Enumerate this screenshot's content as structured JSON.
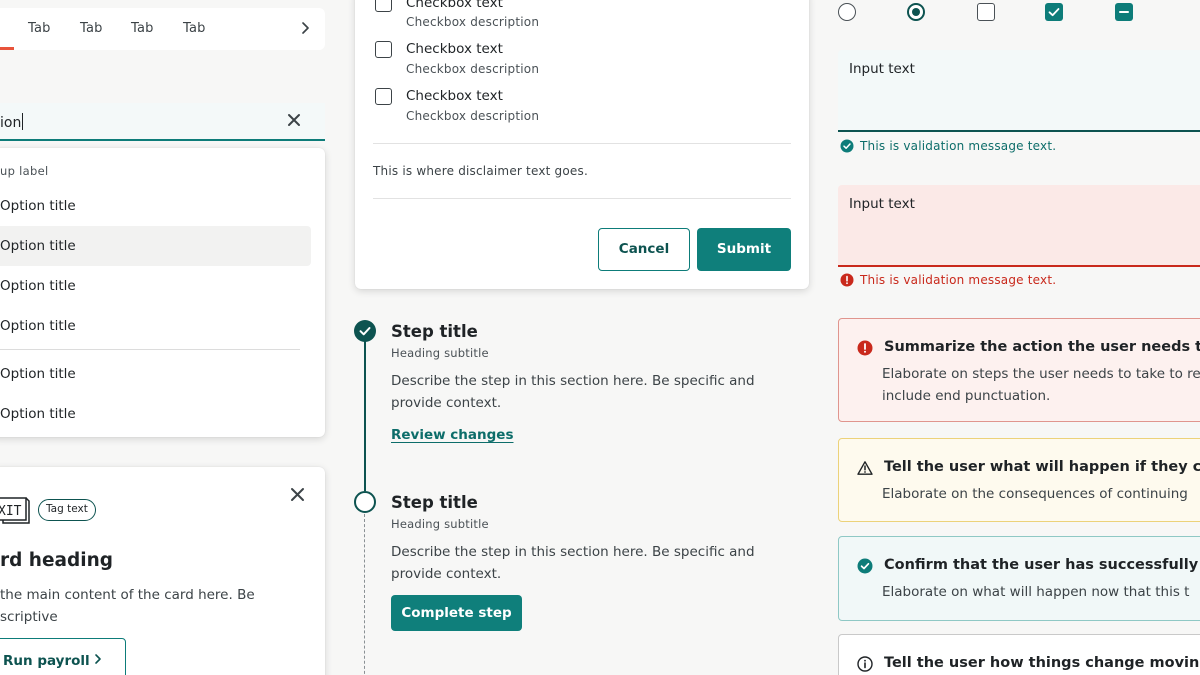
{
  "tabs": {
    "items": [
      {
        "label": "Tab"
      },
      {
        "label": "Tab"
      },
      {
        "label": "Tab"
      },
      {
        "label": "Tab"
      }
    ],
    "next_icon": "chevron-right-icon",
    "accent_color": "#e8533b"
  },
  "combobox": {
    "value": "ion",
    "clear_icon": "close-icon"
  },
  "dropdown": {
    "group_label": "up label",
    "options": [
      {
        "label": "Option title"
      },
      {
        "label": "Option title"
      },
      {
        "label": "Option title"
      },
      {
        "label": "Option title"
      },
      {
        "label": "Option title"
      },
      {
        "label": "Option title"
      }
    ]
  },
  "card": {
    "tag": "Tag text",
    "exit_sign_text": "XIT",
    "heading": "rd heading",
    "body": "the main content of the card here. Be scriptive",
    "button_label": "Run payroll"
  },
  "form": {
    "checkboxes": [
      {
        "label": "Checkbox text",
        "description": "Checkbox description"
      },
      {
        "label": "Checkbox text",
        "description": "Checkbox description"
      },
      {
        "label": "Checkbox text",
        "description": "Checkbox description"
      }
    ],
    "disclaimer": "This is where disclaimer text goes.",
    "cancel_label": "Cancel",
    "submit_label": "Submit"
  },
  "stepper": {
    "steps": [
      {
        "title": "Step title",
        "subtitle": "Heading subtitle",
        "description": "Describe the step in this section here. Be specific and provide context.",
        "link": "Review changes",
        "status": "complete"
      },
      {
        "title": "Step title",
        "subtitle": "Heading subtitle",
        "description": "Describe the step in this section here. Be specific and provide context.",
        "button": "Complete step",
        "status": "current"
      }
    ]
  },
  "controls": {
    "radios": [
      {
        "checked": false
      },
      {
        "checked": true
      }
    ],
    "checkboxes": [
      {
        "state": "unchecked"
      },
      {
        "state": "checked"
      },
      {
        "state": "indeterminate"
      }
    ]
  },
  "inputs": [
    {
      "label": "Input text",
      "validation": "This is validation message text.",
      "state": "success"
    },
    {
      "label": "Input text",
      "validation": "This is validation message text.",
      "state": "error"
    }
  ],
  "alerts": [
    {
      "type": "error",
      "title": "Summarize the action the user needs to t",
      "body": "Elaborate on steps the user needs to take to re include end punctuation."
    },
    {
      "type": "warning",
      "title": "Tell the user what will happen if they con",
      "body": "Elaborate on the consequences of continuing"
    },
    {
      "type": "success",
      "title": "Confirm that the user has successfully com",
      "body": "Elaborate on what will happen now that this t"
    },
    {
      "type": "info",
      "title": "Tell the user how things change moving f",
      "body": ""
    }
  ],
  "colors": {
    "primary": "#0f7f7b",
    "primary_dark": "#0d5350",
    "error": "#c9291c",
    "warning_border": "#ecd27a",
    "success_border": "#8fc8c5"
  }
}
